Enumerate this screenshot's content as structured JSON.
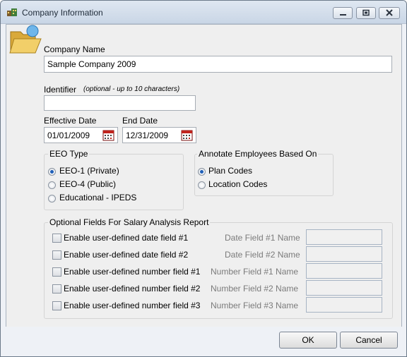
{
  "window": {
    "title": "Company Information",
    "icon": "company-app-icon",
    "controls": [
      "minimize-icon",
      "restore-icon",
      "close-icon"
    ]
  },
  "header_icon": "open-folder-icon",
  "company_name": {
    "label": "Company Name",
    "value": "Sample Company 2009"
  },
  "identifier": {
    "label": "Identifier",
    "hint": "(optional - up to 10 characters)",
    "value": ""
  },
  "effective_date": {
    "label": "Effective Date",
    "value": "01/01/2009",
    "icon": "calendar-icon"
  },
  "end_date": {
    "label": "End Date",
    "value": "12/31/2009",
    "icon": "calendar-icon"
  },
  "eeo_type": {
    "title": "EEO Type",
    "options": [
      {
        "label": "EEO-1 (Private)",
        "selected": true
      },
      {
        "label": "EEO-4 (Public)",
        "selected": false
      },
      {
        "label": "Educational - IPEDS",
        "selected": false
      }
    ]
  },
  "annotate": {
    "title": "Annotate Employees Based On",
    "options": [
      {
        "label": "Plan Codes",
        "selected": true
      },
      {
        "label": "Location Codes",
        "selected": false
      }
    ]
  },
  "optional_fields": {
    "title": "Optional Fields For Salary Analysis Report",
    "rows": [
      {
        "checkbox_label": "Enable user-defined date field #1",
        "name_label": "Date Field #1 Name",
        "checked": false,
        "value": ""
      },
      {
        "checkbox_label": "Enable user-defined date field #2",
        "name_label": "Date Field #2 Name",
        "checked": false,
        "value": ""
      },
      {
        "checkbox_label": "Enable user-defined number field #1",
        "name_label": "Number Field #1 Name",
        "checked": false,
        "value": ""
      },
      {
        "checkbox_label": "Enable user-defined number field #2",
        "name_label": "Number Field #2 Name",
        "checked": false,
        "value": ""
      },
      {
        "checkbox_label": "Enable user-defined number field #3",
        "name_label": "Number Field #3 Name",
        "checked": false,
        "value": ""
      }
    ]
  },
  "buttons": {
    "ok": "OK",
    "cancel": "Cancel"
  },
  "colors": {
    "accent": "#1f5fb8",
    "title_bar": "#d2dceb",
    "dialog_bg": "#efefef",
    "calendar_red": "#c0231d"
  }
}
